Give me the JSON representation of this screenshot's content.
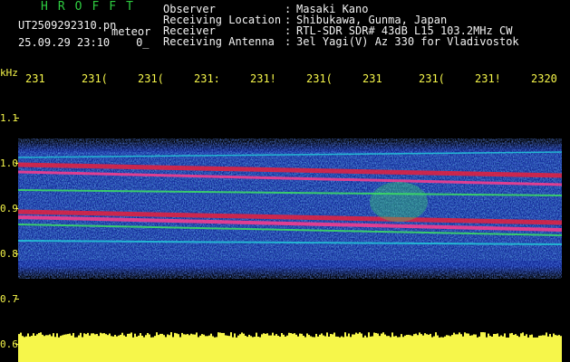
{
  "header": {
    "app_title": "HROFFT",
    "file_name": "UT2509292310.pn",
    "mode": "meteor",
    "timestamp": "25.09.29 23:10",
    "timestamp_suffix": "0_",
    "info": [
      {
        "label": "Observer",
        "value": "Masaki Kano"
      },
      {
        "label": "Receiving Location",
        "value": "Shibukawa, Gunma, Japan"
      },
      {
        "label": "Receiver",
        "value": "RTL-SDR SDR# 43dB L15 103.2MHz CW"
      },
      {
        "label": "Receiving Antenna",
        "value": "3el Yagi(V) Az 330 for Vladivostok"
      }
    ]
  },
  "axes": {
    "frequency_unit": "kHz",
    "frequency_ticks": [
      "1.1",
      "1.0",
      "0.9",
      "0.8",
      "0.7",
      "0.6"
    ],
    "time_ticks": [
      "231",
      "231(",
      "231(",
      "231:",
      "231!",
      "231(",
      "231",
      "231(",
      "231!",
      "2320"
    ]
  },
  "colors": {
    "background": "#000000",
    "label_green": "#2ecc40",
    "label_white": "#f2f2f2",
    "axis_yellow": "#f6f64a",
    "noise_blue": "#1a3cc8",
    "signal_cyan": "#22c8d8",
    "signal_green": "#3ce060",
    "signal_red": "#e8203c",
    "signal_magenta": "#ff3c8c"
  }
}
